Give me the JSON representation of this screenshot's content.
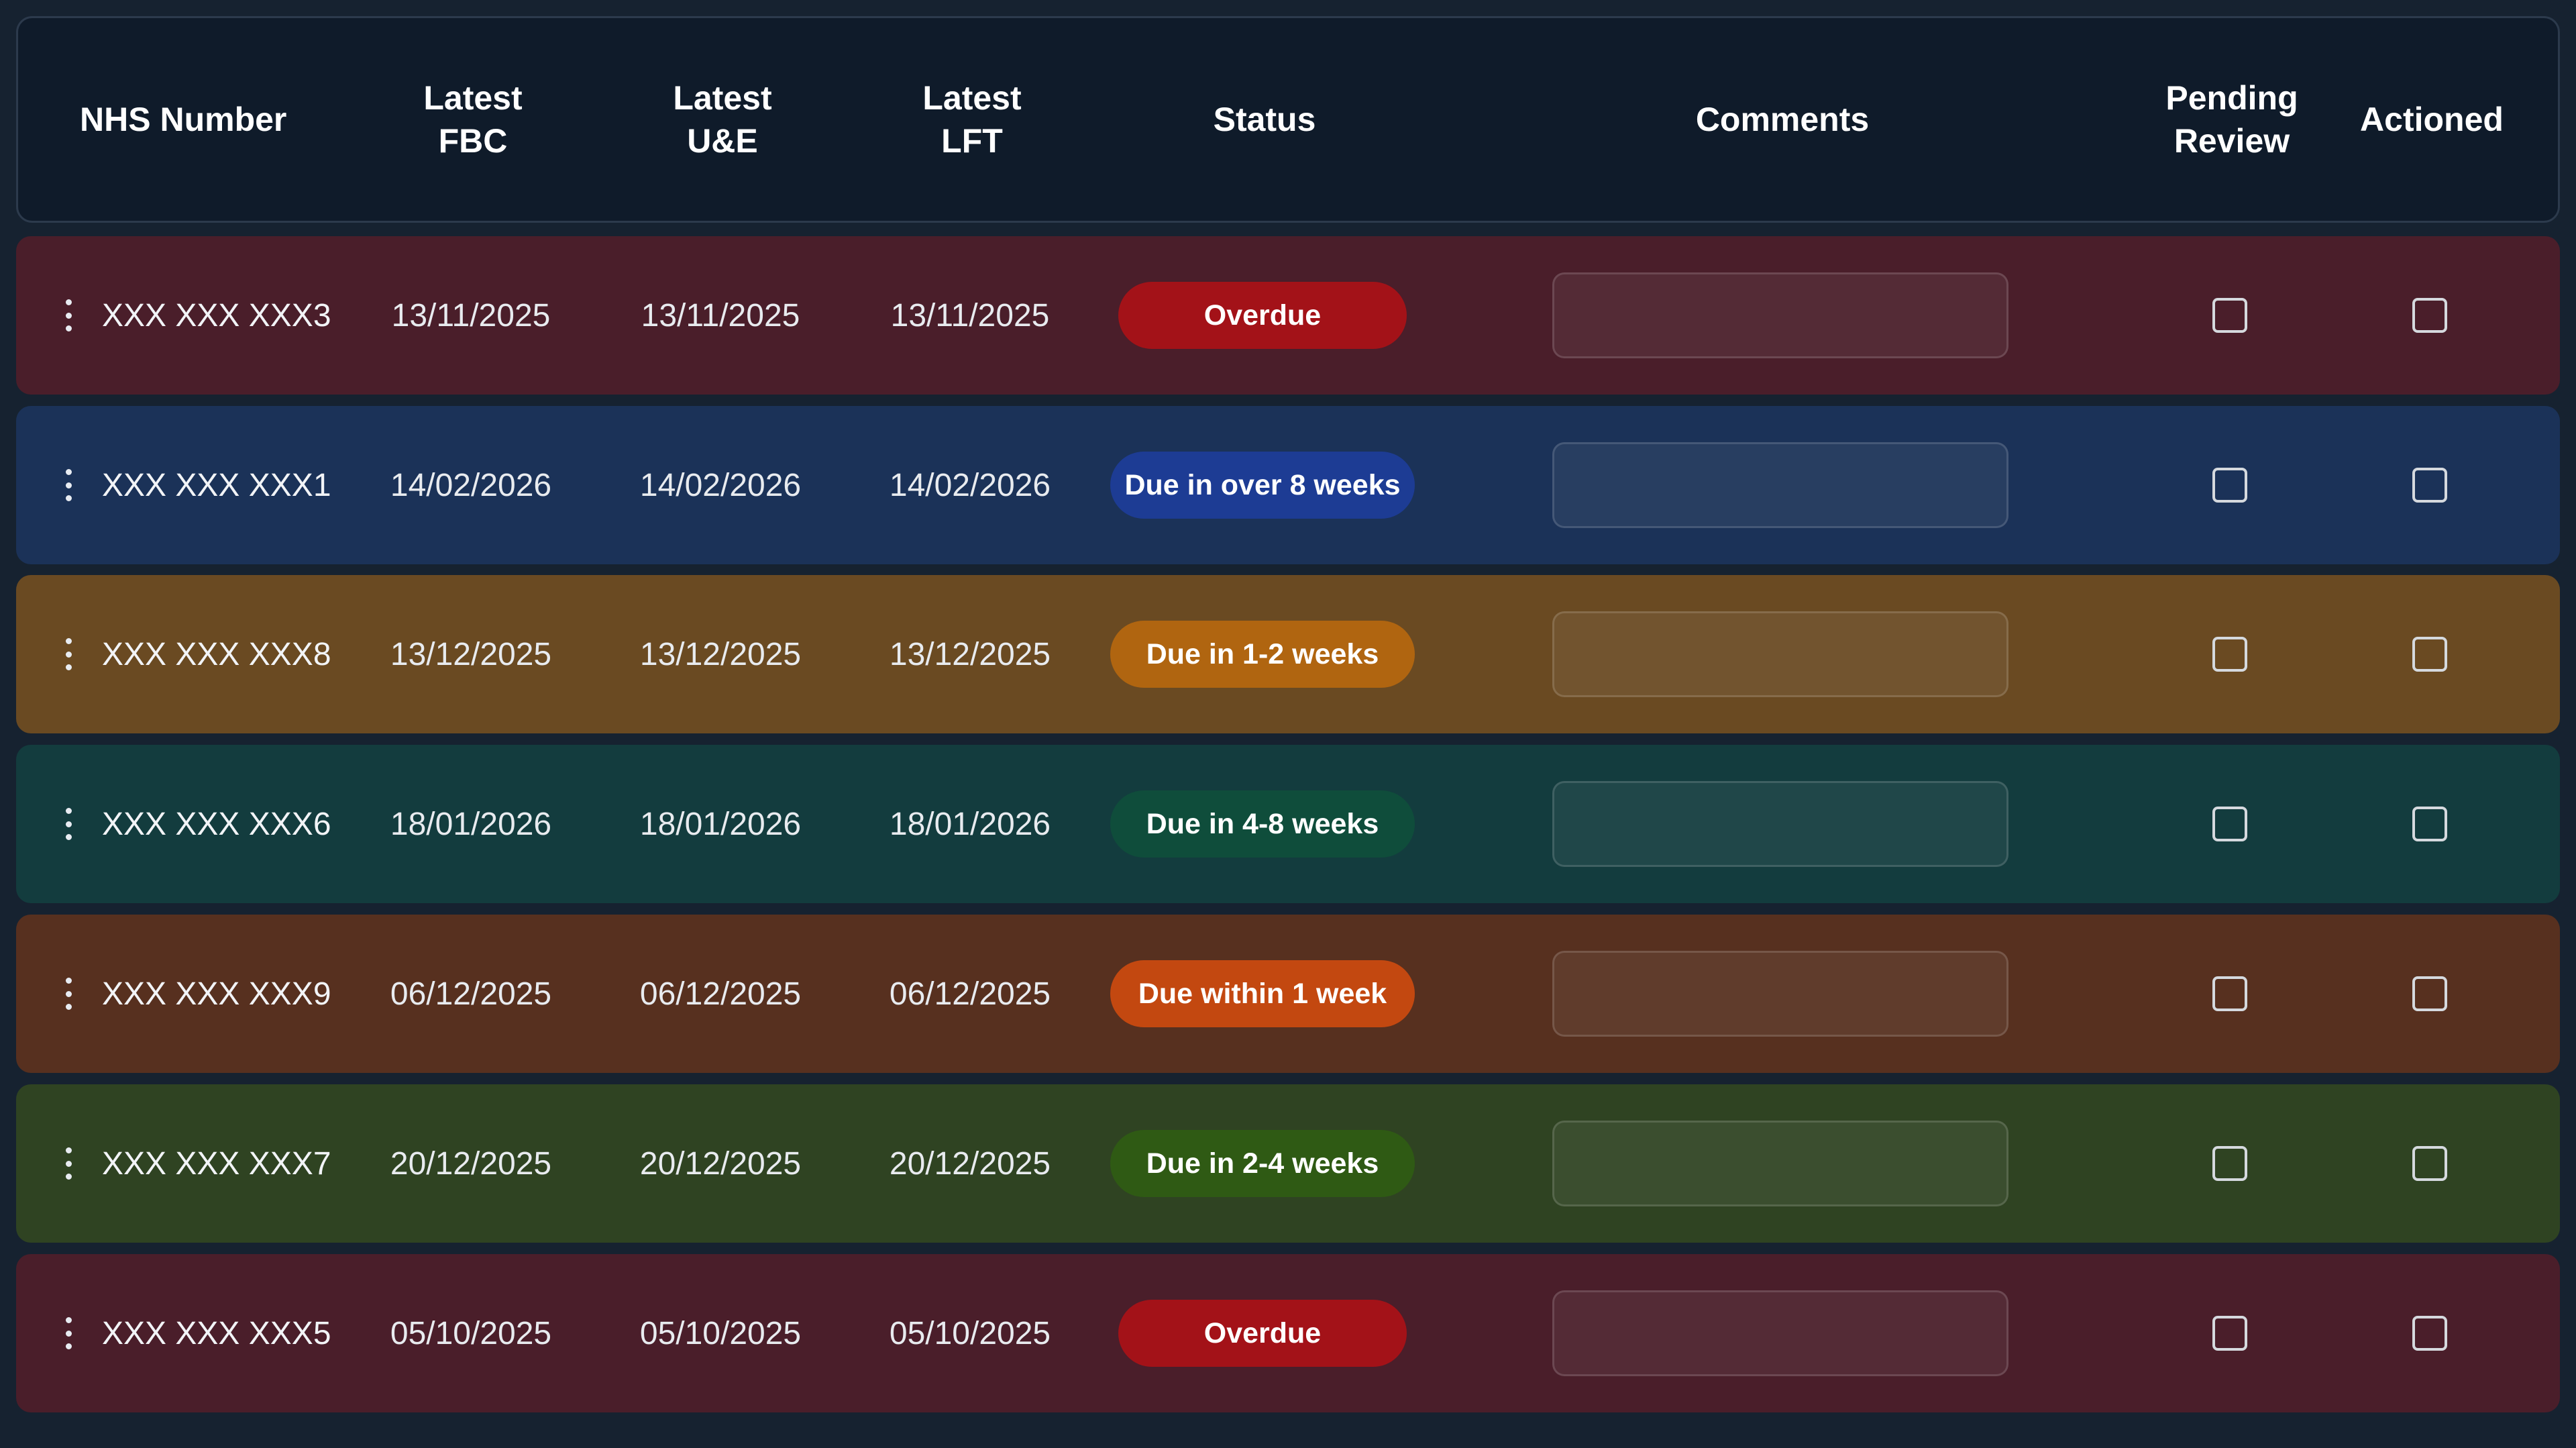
{
  "table": {
    "headers": {
      "nhs": "NHS Number",
      "fbc": [
        "Latest",
        "FBC"
      ],
      "ue": [
        "Latest",
        "U&E"
      ],
      "lft": [
        "Latest",
        "LFT"
      ],
      "status": "Status",
      "comments": "Comments",
      "pending": [
        "Pending",
        "Review"
      ],
      "actioned": "Actioned"
    },
    "rows": [
      {
        "nhs": "XXX XXX XXX3",
        "fbc": "13/11/2025",
        "ue": "13/11/2025",
        "lft": "13/11/2025",
        "status": "Overdue",
        "bg": "#4a1e2a",
        "badge": "#a31218",
        "badge_w": 430
      },
      {
        "nhs": "XXX XXX XXX1",
        "fbc": "14/02/2026",
        "ue": "14/02/2026",
        "lft": "14/02/2026",
        "status": "Due in over 8 weeks",
        "bg": "#1b3258",
        "badge": "#1d3c94",
        "badge_w": 454
      },
      {
        "nhs": "XXX XXX XXX8",
        "fbc": "13/12/2025",
        "ue": "13/12/2025",
        "lft": "13/12/2025",
        "status": "Due in 1-2 weeks",
        "bg": "#6a4a22",
        "badge": "#b06510",
        "badge_w": 454
      },
      {
        "nhs": "XXX XXX XXX6",
        "fbc": "18/01/2026",
        "ue": "18/01/2026",
        "lft": "18/01/2026",
        "status": "Due in 4-8 weeks",
        "bg": "#133c3e",
        "badge": "#0f4d3b",
        "badge_w": 454
      },
      {
        "nhs": "XXX XXX XXX9",
        "fbc": "06/12/2025",
        "ue": "06/12/2025",
        "lft": "06/12/2025",
        "status": "Due within 1 week",
        "bg": "#57301f",
        "badge": "#c34810",
        "badge_w": 454
      },
      {
        "nhs": "XXX XXX XXX7",
        "fbc": "20/12/2025",
        "ue": "20/12/2025",
        "lft": "20/12/2025",
        "status": "Due in 2-4 weeks",
        "bg": "#2f4322",
        "badge": "#2f5a14",
        "badge_w": 454
      },
      {
        "nhs": "XXX XXX XXX5",
        "fbc": "05/10/2025",
        "ue": "05/10/2025",
        "lft": "05/10/2025",
        "status": "Overdue",
        "bg": "#4a1e2a",
        "badge": "#a31218",
        "badge_w": 430
      }
    ]
  }
}
